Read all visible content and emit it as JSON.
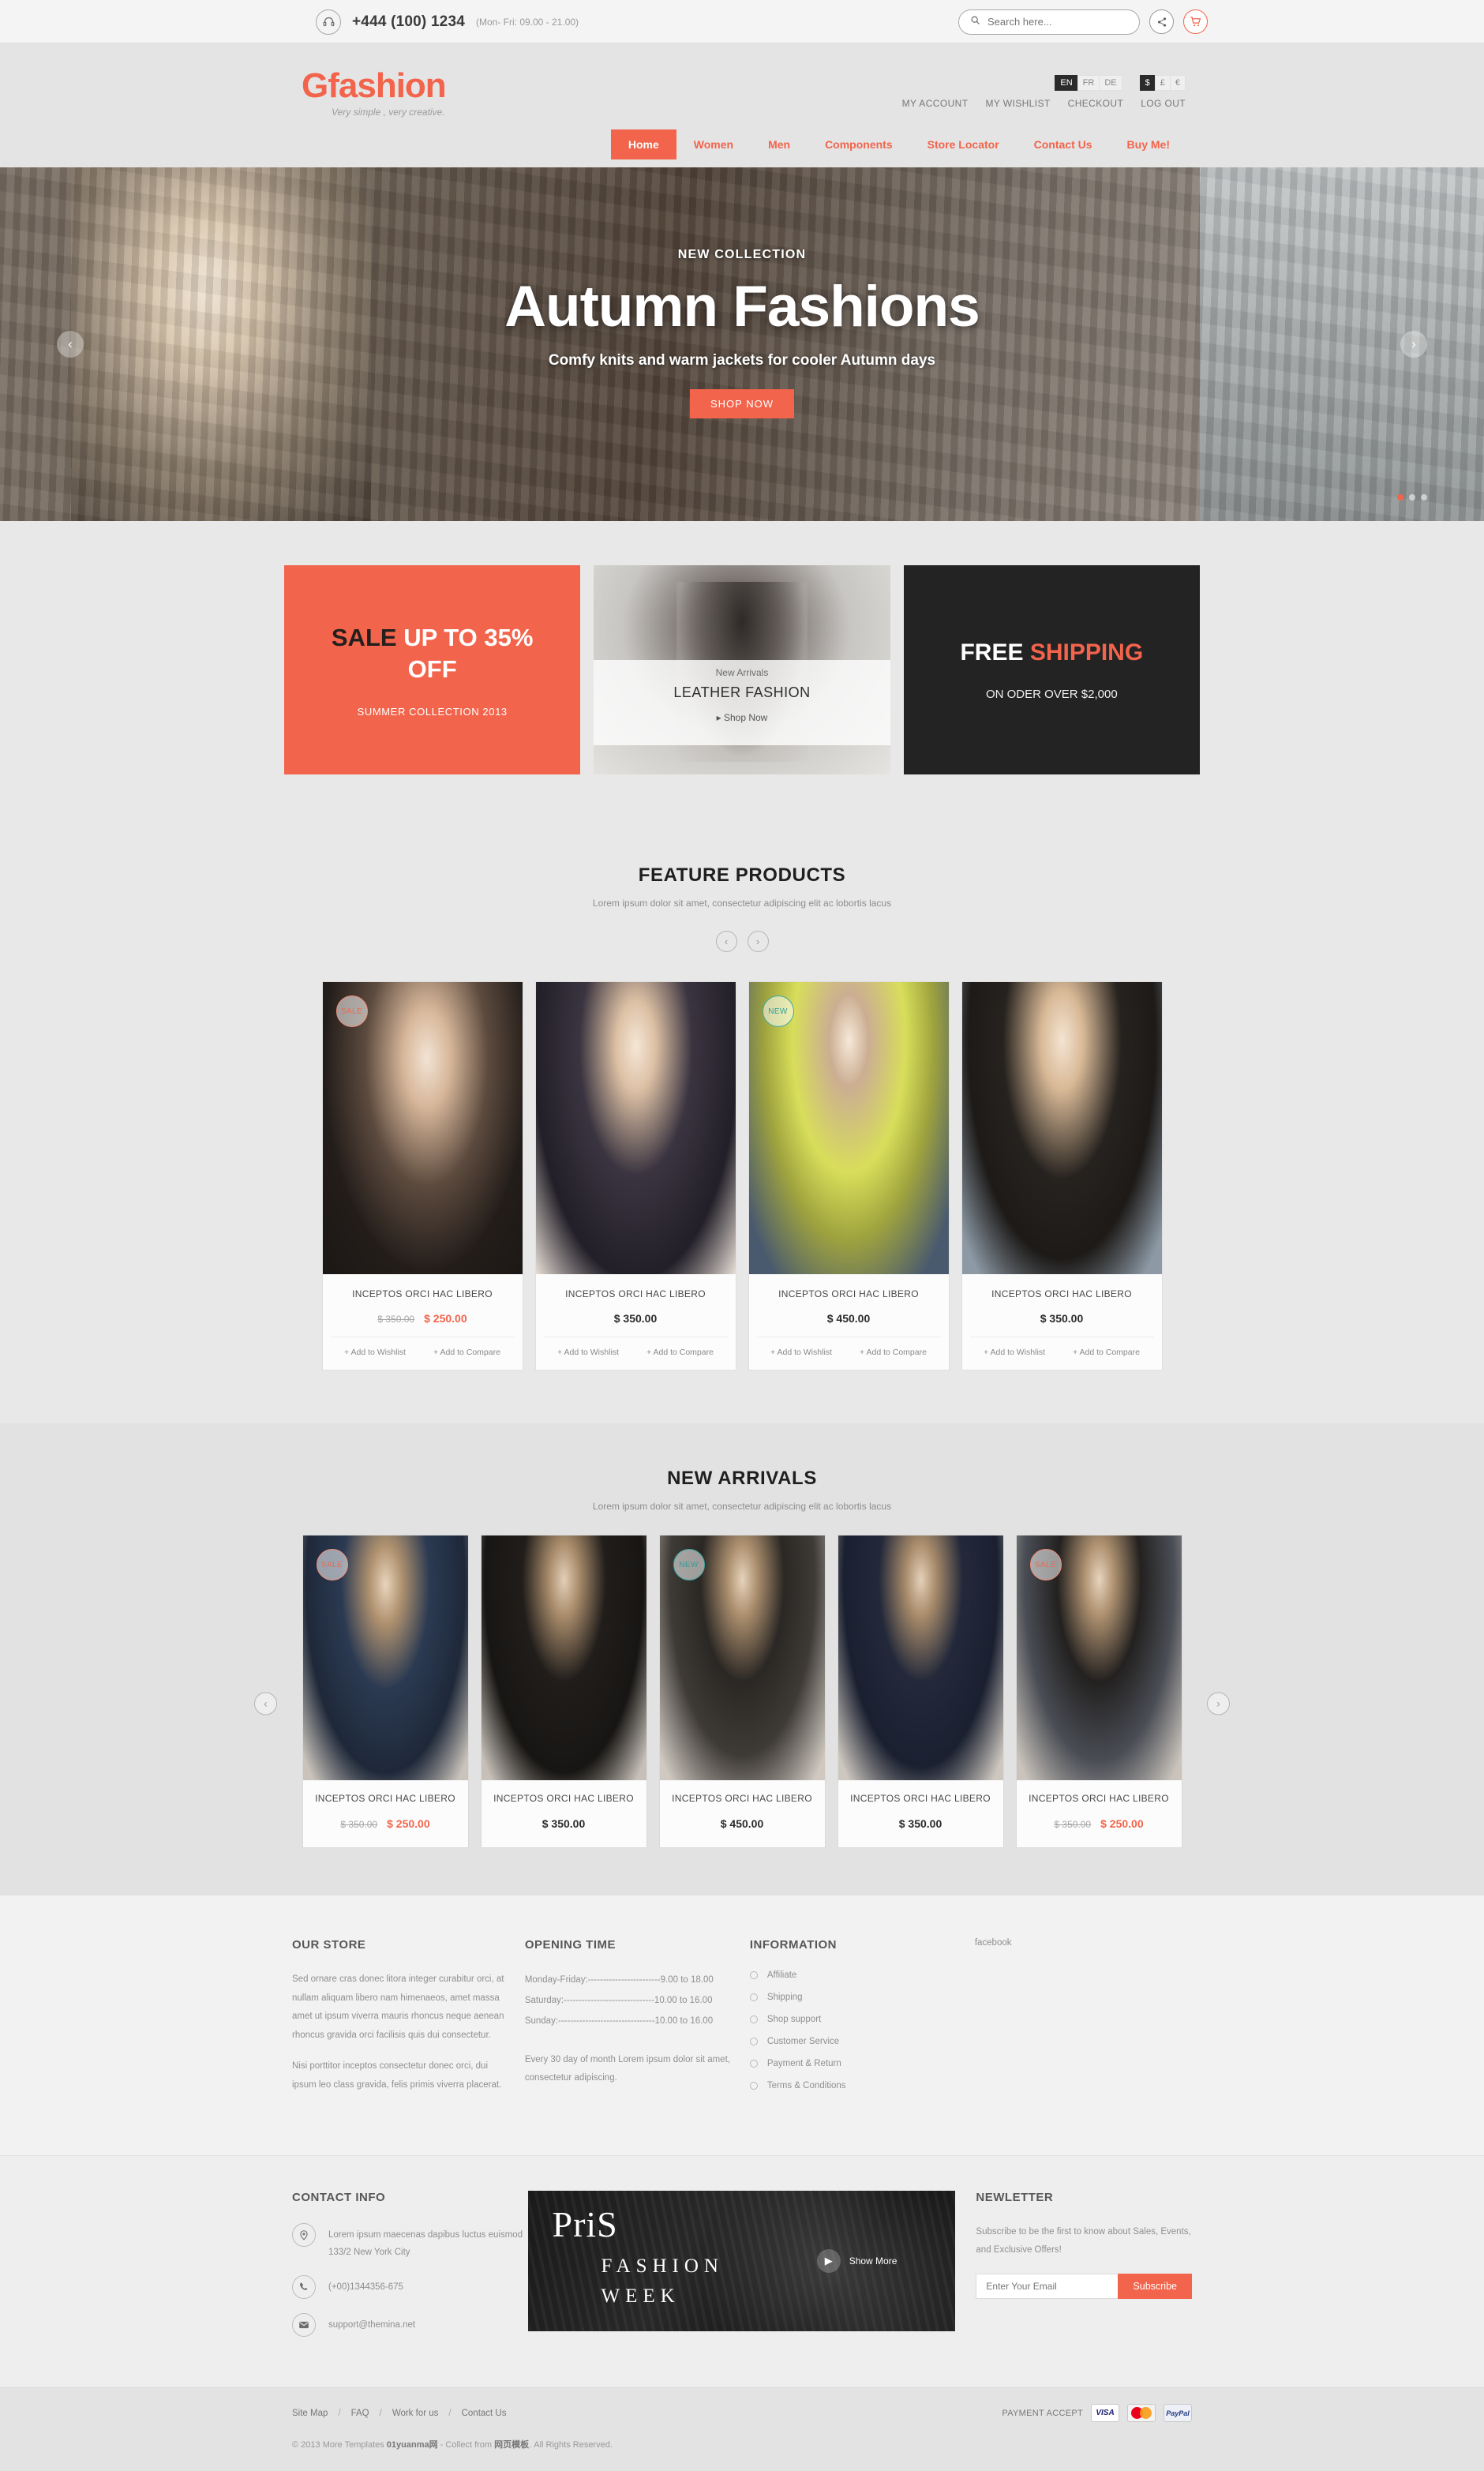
{
  "topbar": {
    "phone_icon": "headset-icon",
    "phone": "+444 (100) 1234",
    "hours": "(Mon- Fri: 09.00 - 21.00)",
    "search_placeholder": "Search here...",
    "share_icon": "share-icon",
    "cart_icon": "cart-icon"
  },
  "header": {
    "logo_g": "G",
    "logo_rest": "fashion",
    "tagline": "Very simple , very creative.",
    "account_links": [
      "MY ACCOUNT",
      "MY WISHLIST",
      "CHECKOUT",
      "LOG OUT"
    ],
    "languages": [
      {
        "label": "EN",
        "active": true
      },
      {
        "label": "FR",
        "active": false
      },
      {
        "label": "DE",
        "active": false
      }
    ],
    "currencies": [
      {
        "label": "$",
        "active": true
      },
      {
        "label": "£",
        "active": false
      },
      {
        "label": "€",
        "active": false
      }
    ],
    "nav": [
      {
        "label": "Home",
        "active": true
      },
      {
        "label": "Women",
        "active": false
      },
      {
        "label": "Men",
        "active": false
      },
      {
        "label": "Components",
        "active": false
      },
      {
        "label": "Store Locator",
        "active": false
      },
      {
        "label": "Contact Us",
        "active": false
      },
      {
        "label": "Buy Me!",
        "active": false
      }
    ]
  },
  "hero": {
    "kicker": "NEW COLLECTION",
    "title": "Autumn Fashions",
    "subtitle": "Comfy knits and warm jackets for cooler Autumn days",
    "button": "SHOP NOW",
    "prev_icon": "chevron-left-icon",
    "next_icon": "chevron-right-icon",
    "slide_count": 3,
    "active_slide": 1
  },
  "promos": {
    "sale": {
      "word_dark": "SALE",
      "word_light": "UP TO 35% OFF",
      "sub": "SUMMER COLLECTION 2013"
    },
    "leather": {
      "kicker": "New Arrivals",
      "title": "LEATHER FASHION",
      "link": "Shop Now",
      "link_icon": "play-triangle-icon"
    },
    "shipping": {
      "word_white": "FREE",
      "word_accent": "SHIPPING",
      "sub": "ON ODER OVER $2,000"
    }
  },
  "feature_products": {
    "title": "FEATURE PRODUCTS",
    "subtitle": "Lorem ipsum dolor sit amet, consectetur adipiscing elit ac lobortis lacus",
    "prev_icon": "chevron-left-icon",
    "next_icon": "chevron-right-icon",
    "wishlist_label": "+ Add to Wishlist",
    "compare_label": "+ Add to Compare",
    "items": [
      {
        "badge": "SALE",
        "badge_type": "sale",
        "name": "INCEPTOS ORCI HAC LIBERO",
        "old_price": "$ 350.00",
        "price": "$ 250.00",
        "on_sale": true,
        "photo": "p1"
      },
      {
        "badge": "",
        "badge_type": "",
        "name": "INCEPTOS ORCI HAC LIBERO",
        "old_price": "",
        "price": "$ 350.00",
        "on_sale": false,
        "photo": "p2"
      },
      {
        "badge": "NEW",
        "badge_type": "new",
        "name": "INCEPTOS ORCI HAC LIBERO",
        "old_price": "",
        "price": "$ 450.00",
        "on_sale": false,
        "photo": "p3"
      },
      {
        "badge": "",
        "badge_type": "",
        "name": "INCEPTOS ORCI HAC LIBERO",
        "old_price": "",
        "price": "$ 350.00",
        "on_sale": false,
        "photo": "p4"
      }
    ]
  },
  "new_arrivals": {
    "title": "NEW ARRIVALS",
    "subtitle": "Lorem ipsum dolor sit amet, consectetur adipiscing elit ac lobortis lacus",
    "prev_icon": "chevron-left-icon",
    "next_icon": "chevron-right-icon",
    "items": [
      {
        "badge": "SALE",
        "badge_type": "sale",
        "name": "INCEPTOS ORCI HAC LIBERO",
        "old_price": "$ 350.00",
        "price": "$ 250.00",
        "on_sale": true,
        "photo": "m1"
      },
      {
        "badge": "",
        "badge_type": "",
        "name": "INCEPTOS ORCI HAC LIBERO",
        "old_price": "",
        "price": "$ 350.00",
        "on_sale": false,
        "photo": "m2"
      },
      {
        "badge": "NEW",
        "badge_type": "new",
        "name": "INCEPTOS ORCI HAC LIBERO",
        "old_price": "",
        "price": "$ 450.00",
        "on_sale": false,
        "photo": "m3"
      },
      {
        "badge": "",
        "badge_type": "",
        "name": "INCEPTOS ORCI HAC LIBERO",
        "old_price": "",
        "price": "$ 350.00",
        "on_sale": false,
        "photo": "m4"
      },
      {
        "badge": "SALE",
        "badge_type": "sale",
        "name": "INCEPTOS ORCI HAC LIBERO",
        "old_price": "$ 350.00",
        "price": "$ 250.00",
        "on_sale": true,
        "photo": "m5"
      }
    ]
  },
  "footer": {
    "our_store": {
      "title": "OUR STORE",
      "p1": "Sed ornare cras donec litora integer curabitur orci, at nullam aliquam libero nam himenaeos, amet massa amet ut ipsum viverra mauris rhoncus neque aenean rhoncus gravida orci facilisis quis dui consectetur.",
      "p2": "Nisi porttitor inceptos consectetur donec orci, dui ipsum leo class gravida, felis primis viverra placerat."
    },
    "opening_time": {
      "title": "OPENING TIME",
      "rows": [
        "Monday-Friday:------------------------9.00 to 18.00",
        "Saturday:------------------------------10.00 to 16.00",
        "Sunday:--------------------------------10.00 to 16.00"
      ],
      "note": "Every 30 day of month Lorem ipsum dolor sit amet, consectetur adipiscing."
    },
    "information": {
      "title": "INFORMATION",
      "items": [
        "Affiliate",
        "Shipping",
        "Shop support",
        "Customer Service",
        "Payment & Return",
        "Terms & Conditions"
      ]
    },
    "social": {
      "facebook": "facebook"
    },
    "contact": {
      "title": "CONTACT INFO",
      "address_icon": "map-pin-icon",
      "address": "Lorem ipsum maecenas dapibus luctus euismod 133/2 New York City",
      "phone_icon": "phone-icon",
      "phone": "(+00)1344356-675",
      "email_icon": "envelope-icon",
      "email": "support@themina.net"
    },
    "paris_banner": {
      "line1": "PriS",
      "line2": "FASHION",
      "line3": "WEEK",
      "more_label": "Show More",
      "more_icon": "play-circle-icon"
    },
    "newsletter": {
      "title": "NEWLETTER",
      "text": "Subscribe to be the first to know about Sales, Events, and Exclusive Offers!",
      "placeholder": "Enter Your Email",
      "button": "Subscribe"
    },
    "bottom": {
      "links": [
        "Site Map",
        "FAQ",
        "Work for us",
        "Contact Us"
      ],
      "separator": "/",
      "payment_label": "PAYMENT ACCEPT",
      "cards": [
        "VISA",
        "MasterCard",
        "PayPal"
      ],
      "copyright": "© 2013 More Templates 01yuanma网 - Collect from 网页模板. All Rights Reserved.",
      "copyright_pre": "© 2013 More Templates ",
      "copyright_hl": "01yuanma网",
      "copyright_mid": " - Collect from ",
      "copyright_hl2": "网页模板",
      "copyright_post": ". All Rights Reserved."
    }
  },
  "colors": {
    "accent": "#f2644b",
    "dark": "#232323",
    "teal": "#2f9e98"
  }
}
